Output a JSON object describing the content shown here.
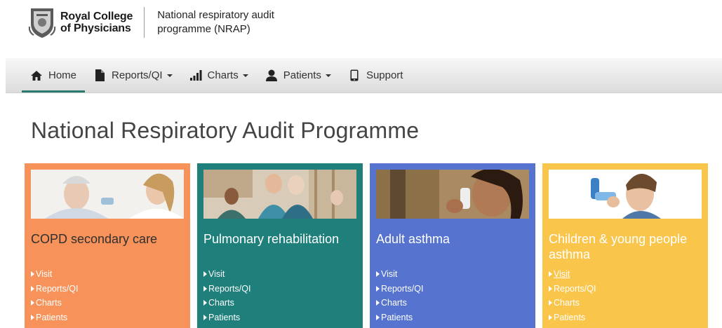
{
  "header": {
    "org_name_line1": "Royal College",
    "org_name_line2": "of Physicians",
    "programme_line1": "National respiratory audit",
    "programme_line2": "programme (NRAP)"
  },
  "nav": {
    "items": [
      {
        "label": "Home",
        "icon": "home-icon",
        "active": true
      },
      {
        "label": "Reports/QI",
        "icon": "document-icon",
        "dropdown": true
      },
      {
        "label": "Charts",
        "icon": "bar-chart-icon",
        "dropdown": true
      },
      {
        "label": "Patients",
        "icon": "user-icon",
        "dropdown": true
      },
      {
        "label": "Support",
        "icon": "phone-icon"
      }
    ]
  },
  "page": {
    "title": "National Respiratory Audit Programme"
  },
  "cards": [
    {
      "title": "COPD secondary care",
      "color": "#f7935a",
      "links": [
        "Visit",
        "Reports/QI",
        "Charts",
        "Patients"
      ]
    },
    {
      "title": "Pulmonary rehabilitation",
      "color": "#1e7f7b",
      "links": [
        "Visit",
        "Reports/QI",
        "Charts",
        "Patients"
      ]
    },
    {
      "title": "Adult asthma",
      "color": "#5573cf",
      "links": [
        "Visit",
        "Reports/QI",
        "Charts",
        "Patients"
      ]
    },
    {
      "title": "Children & young people asthma",
      "color": "#fac54b",
      "links": [
        "Visit",
        "Reports/QI",
        "Charts",
        "Patients"
      ]
    }
  ],
  "colors": {
    "nav_active_underline": "#2a7a70"
  }
}
